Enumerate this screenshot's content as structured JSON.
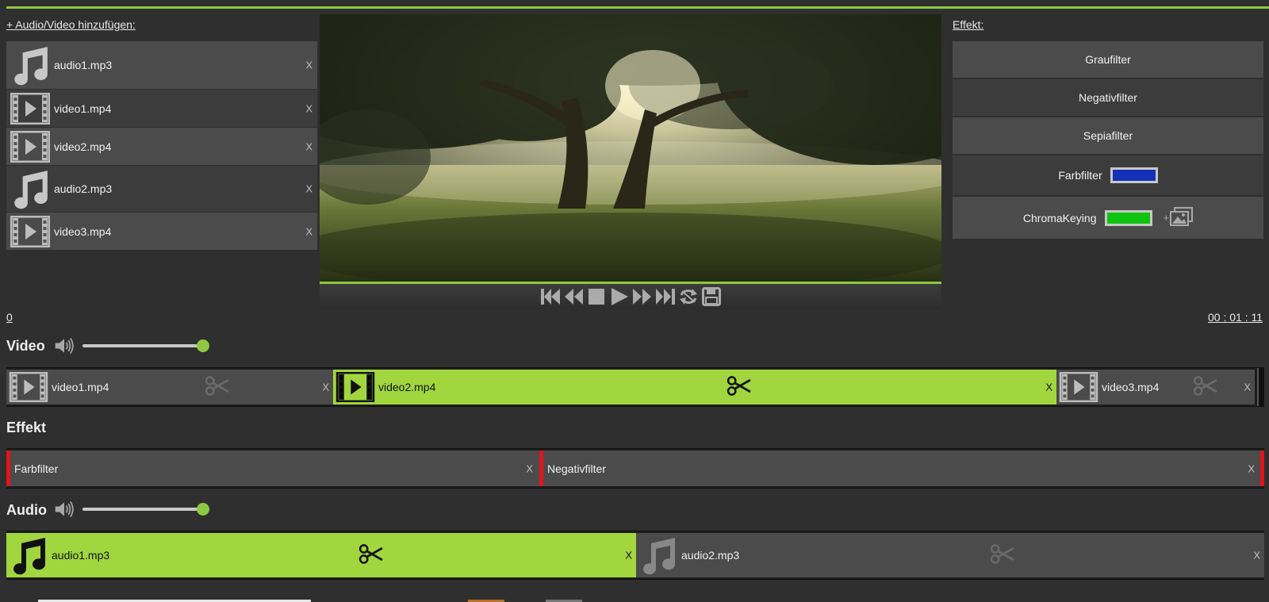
{
  "header": {
    "add_media_label": "+ Audio/Video hinzufügen:",
    "effect_label": "Effekt:"
  },
  "media_list": [
    {
      "type": "audio",
      "icon": "music-note-icon",
      "name": "audio1.mp3",
      "remove": "X"
    },
    {
      "type": "video",
      "icon": "film-strip-icon",
      "name": "video1.mp4",
      "remove": "X"
    },
    {
      "type": "video",
      "icon": "film-strip-icon",
      "name": "video2.mp4",
      "remove": "X"
    },
    {
      "type": "audio",
      "icon": "music-note-icon",
      "name": "audio2.mp3",
      "remove": "X"
    },
    {
      "type": "video",
      "icon": "film-strip-icon",
      "name": "video3.mp4",
      "remove": "X"
    }
  ],
  "effects": {
    "gray": "Graufilter",
    "negative": "Negativfilter",
    "sepia": "Sepiafilter",
    "color": {
      "label": "Farbfilter",
      "color": "#1530b8"
    },
    "chroma": {
      "label": "ChromaKeying",
      "color": "#0fc40f",
      "add_image_prefix": "+"
    }
  },
  "player": {
    "controls": [
      "skip-to-start-icon",
      "rewind-icon",
      "stop-icon",
      "play-icon",
      "fast-forward-icon",
      "skip-to-end-icon",
      "loop-icon",
      "save-icon"
    ]
  },
  "timeline": {
    "start": "0",
    "end": "00 : 01 : 11"
  },
  "video_track": {
    "title": "Video",
    "volume": 1.0,
    "clips": [
      {
        "name": "video1.mp4",
        "remove": "X",
        "selected": false
      },
      {
        "name": "video2.mp4",
        "remove": "X",
        "selected": true
      },
      {
        "name": "video3.mp4",
        "remove": "X",
        "selected": false
      }
    ]
  },
  "effect_track": {
    "title": "Effekt",
    "clips": [
      {
        "name": "Farbfilter",
        "remove": "X"
      },
      {
        "name": "Negativfilter",
        "remove": "X"
      }
    ]
  },
  "audio_track": {
    "title": "Audio",
    "volume": 1.0,
    "clips": [
      {
        "name": "audio1.mp3",
        "remove": "X",
        "selected": true
      },
      {
        "name": "audio2.mp3",
        "remove": "X",
        "selected": false
      }
    ]
  },
  "colors": {
    "accent": "#8fc742",
    "selected_clip": "#a1d63e",
    "effect_marker": "#e0141a",
    "panel": "#4b4b4b",
    "background": "#2f2f2f"
  }
}
